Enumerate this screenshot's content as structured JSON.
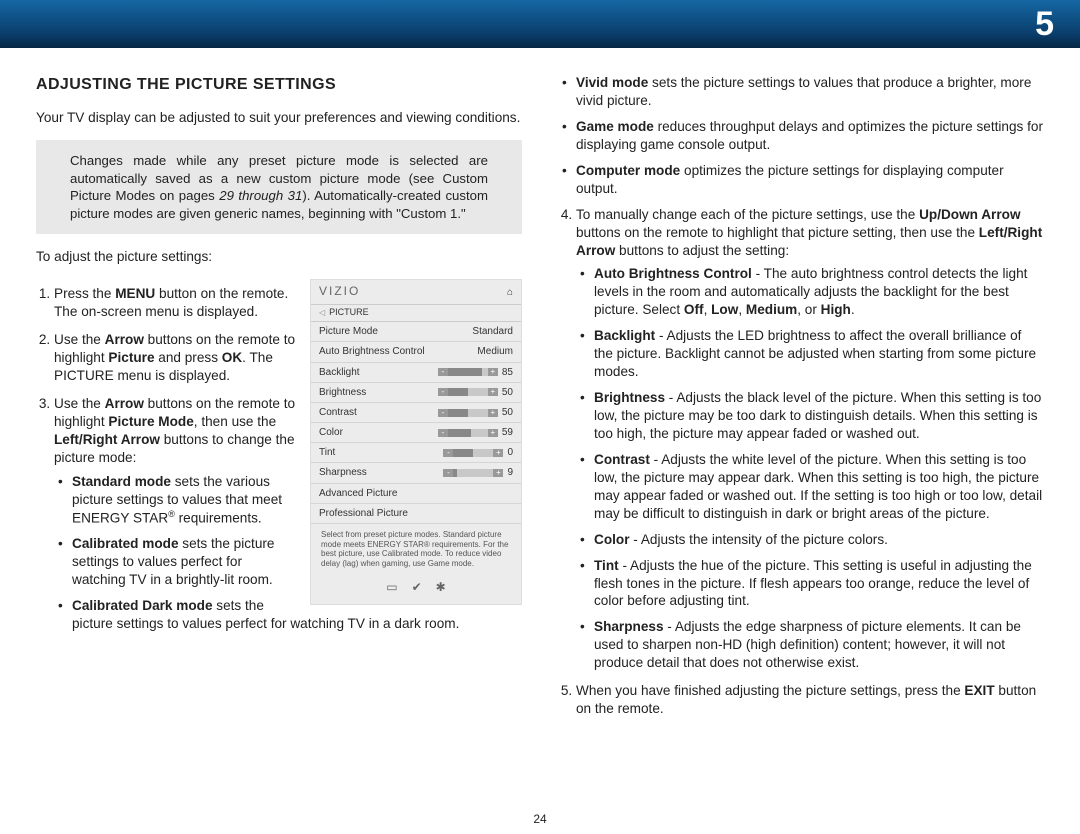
{
  "chapter_number": "5",
  "heading": "ADJUSTING THE PICTURE SETTINGS",
  "intro": "Your TV display can be adjusted to suit your preferences and viewing conditions.",
  "note_a": "Changes made while any preset picture mode is selected are automatically saved as a new custom picture mode (see Custom Picture Modes on pages ",
  "note_em": "29 through 31",
  "note_b": "). Automatically-created custom picture modes are given generic names, beginning with \"Custom 1.\"",
  "lead": "To adjust the picture settings:",
  "step1_a": "Press the ",
  "step1_b": " button on the remote. The on-screen menu is displayed.",
  "step2_a": "Use the ",
  "step2_b": " buttons on the remote to highlight ",
  "step2_c": " and press ",
  "step2_d": ". The PICTURE menu is displayed.",
  "step3_a": "Use the ",
  "step3_b": " buttons on the remote to highlight ",
  "step3_c": ", then use the ",
  "step3_d": " buttons to change the picture mode:",
  "std_a": "Standard mode",
  "std_b": " sets the various picture settings to values that meet ENERGY STAR",
  "std_c": " requirements.",
  "cal_a": "Calibrated mode",
  "cal_b": " sets the picture settings to values perfect for watching TV in a brightly-lit room.",
  "cald_a": "Calibrated Dark mode",
  "cald_b": " sets the picture settings to values perfect for watching TV in a dark room.",
  "viv_a": "Vivid mode",
  "viv_b": " sets the picture settings to values that produce a brighter, more vivid picture.",
  "game_a": "Game mode",
  "game_b": " reduces throughput delays and optimizes the picture settings for displaying game console output.",
  "comp_a": "Computer mode",
  "comp_b": " optimizes the picture settings for displaying computer output.",
  "step4_a": "To manually change each of the picture settings, use the ",
  "step4_b": " buttons on the remote to highlight that picture setting, then use the ",
  "step4_c": " buttons to adjust the setting:",
  "abc_a": "Auto Brightness Control",
  "abc_b": " - The auto brightness control detects the light levels in the room and automatically adjusts the backlight for the best picture. Select ",
  "abc_c": ", or ",
  "bl_a": "Backlight",
  "bl_b": " - Adjusts the LED brightness to affect the overall brilliance of the picture. Backlight cannot be adjusted when starting from some picture modes.",
  "br_a": "Brightness",
  "br_b": " - Adjusts the black level of the picture. When this setting is too low, the picture may be too dark to distinguish details. When this setting is too high, the picture may appear faded or washed out.",
  "ct_a": "Contrast",
  "ct_b": " - Adjusts the white level of the picture. When this setting is too low, the picture may appear dark. When this setting is too high, the picture may appear faded or washed out. If the setting is too high or too low, detail may be difficult to distinguish in dark or bright areas of the picture.",
  "co_a": "Color",
  "co_b": " - Adjusts the intensity of the picture colors.",
  "ti_a": "Tint",
  "ti_b": " - Adjusts the hue of the picture. This setting is useful in adjusting the flesh tones in the picture. If flesh appears too orange, reduce the level of color before adjusting tint.",
  "sh_a": "Sharpness",
  "sh_b": " - Adjusts the edge sharpness of picture elements. It can be used to sharpen non-HD (high definition) content; however, it will not produce detail that does not otherwise exist.",
  "step5_a": "When you have finished adjusting the picture settings, press the ",
  "step5_b": " button on the remote.",
  "menu": {
    "brand": "VIZIO",
    "section": "PICTURE",
    "rows": {
      "picture_mode": {
        "label": "Picture Mode",
        "value": "Standard"
      },
      "abc": {
        "label": "Auto Brightness Control",
        "value": "Medium"
      },
      "backlight": {
        "label": "Backlight",
        "value": "85",
        "pct": 85
      },
      "brightness": {
        "label": "Brightness",
        "value": "50",
        "pct": 50
      },
      "contrast": {
        "label": "Contrast",
        "value": "50",
        "pct": 50
      },
      "color": {
        "label": "Color",
        "value": "59",
        "pct": 59
      },
      "tint": {
        "label": "Tint",
        "value": "0",
        "pct": 50
      },
      "sharpness": {
        "label": "Sharpness",
        "value": "9",
        "pct": 9
      },
      "adv": {
        "label": "Advanced Picture"
      },
      "pro": {
        "label": "Professional Picture"
      }
    },
    "blurb": "Select from preset picture modes. Standard picture mode meets ENERGY STAR® requirements. For the best picture, use Calibrated mode. To reduce video delay (lag) when gaming, use Game mode."
  },
  "labels": {
    "menu_btn": "MENU",
    "arrow": "Arrow",
    "picture": "Picture",
    "ok": "OK",
    "picture_mode": "Picture Mode",
    "lr": "Left/Right Arrow",
    "ud": "Up/Down Arrow",
    "off": "Off",
    "low": "Low",
    "medium": "Medium",
    "high": "High",
    "exit": "EXIT"
  },
  "page_number": "24"
}
